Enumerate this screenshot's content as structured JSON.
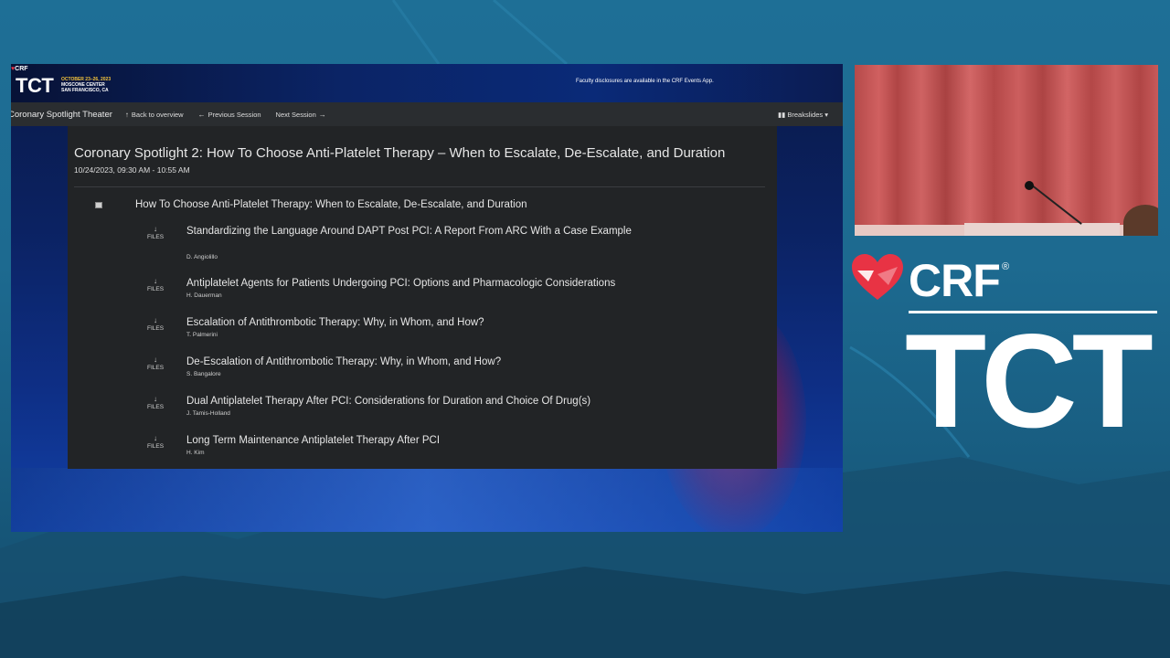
{
  "slide": {
    "logo": {
      "crf": "CRF",
      "tct": "TCT",
      "dates": "OCTOBER 23–26, 2023",
      "venue": "MOSCONE CENTER",
      "city": "SAN FRANCISCO, CA"
    },
    "disclosure": "Faculty disclosures are available in the CRF Events App."
  },
  "navbar": {
    "title": "Coronary Spotlight Theater",
    "back": "Back to overview",
    "previous": "Previous Session",
    "next": "Next Session",
    "breakslides": "Breakslides"
  },
  "session": {
    "title": "Coronary Spotlight 2: How To Choose Anti-Platelet Therapy – When to Escalate, De-Escalate, and Duration",
    "datetime": "10/24/2023, 09:30 AM - 10:55 AM",
    "main_talk": "How To Choose Anti-Platelet Therapy: When to Escalate, De-Escalate, and Duration",
    "files_label": "FILES",
    "talks": [
      {
        "title": "Standardizing the Language Around DAPT Post PCI: A Report From ARC With a Case Example",
        "speaker": "D. Angiolillo"
      },
      {
        "title": "Antiplatelet Agents for Patients Undergoing PCI: Options and Pharmacologic Considerations",
        "speaker": "H. Dauerman"
      },
      {
        "title": "Escalation of Antithrombotic Therapy: Why, in Whom, and How?",
        "speaker": "T. Palmerini"
      },
      {
        "title": "De-Escalation of Antithrombotic Therapy: Why, in Whom, and How?",
        "speaker": "S. Bangalore"
      },
      {
        "title": "Dual Antiplatelet Therapy After PCI: Considerations for Duration and Choice Of Drug(s)",
        "speaker": "J. Tamis-Holland"
      },
      {
        "title": "Long Term Maintenance Antiplatelet Therapy After PCI",
        "speaker": "H. Kim"
      }
    ]
  },
  "brand": {
    "crf": "CRF",
    "reg": "®",
    "tct": "TCT"
  },
  "colors": {
    "accent_red": "#e83344",
    "background_blue": "#1e6f96",
    "card": "#222426",
    "navbar": "#2a2d30"
  }
}
